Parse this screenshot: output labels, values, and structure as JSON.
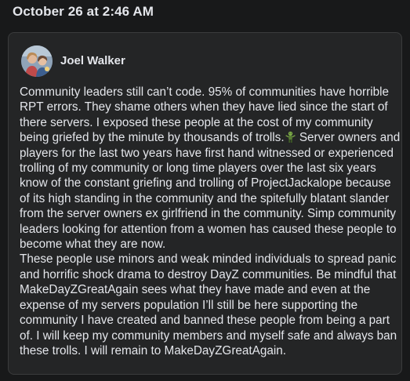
{
  "post": {
    "timestamp": "October 26 at 2:46 AM",
    "comment": {
      "author": "Joel Walker",
      "avatar_icon": "profile-photo",
      "paragraph1_before_emoji": "Community leaders still can’t code. 95% of communities have horrible RPT errors. They shame others when they have lied since the start of there servers. I exposed these people at the cost of my community being griefed by the minute by thousands of trolls.",
      "emoji_icon": "zombie-emoji",
      "paragraph1_after_emoji": " Server owners and players for the last two years have first hand witnessed or experienced trolling of my community or long time players over the last six years know of the constant griefing and trolling of ProjectJackalope because of its high standing in the community and the spitefully blatant slander from the server owners ex girlfriend in the community. Simp community leaders looking for attention from a women has caused these people to become what they are now.",
      "paragraph2": "These people use minors and weak minded individuals to spread panic and horrific shock drama to destroy DayZ communities. Be mindful that MakeDayZGreatAgain sees what they have made and even at the expense of my servers population I’ll still be here supporting the community I have created and banned these people from being a part of. I will keep my community members and myself safe and always ban these trolls. I will remain to MakeDayZGreatAgain."
    }
  },
  "colors": {
    "page_background": "#18191a",
    "card_background": "#242526",
    "text": "#e4e6eb"
  }
}
